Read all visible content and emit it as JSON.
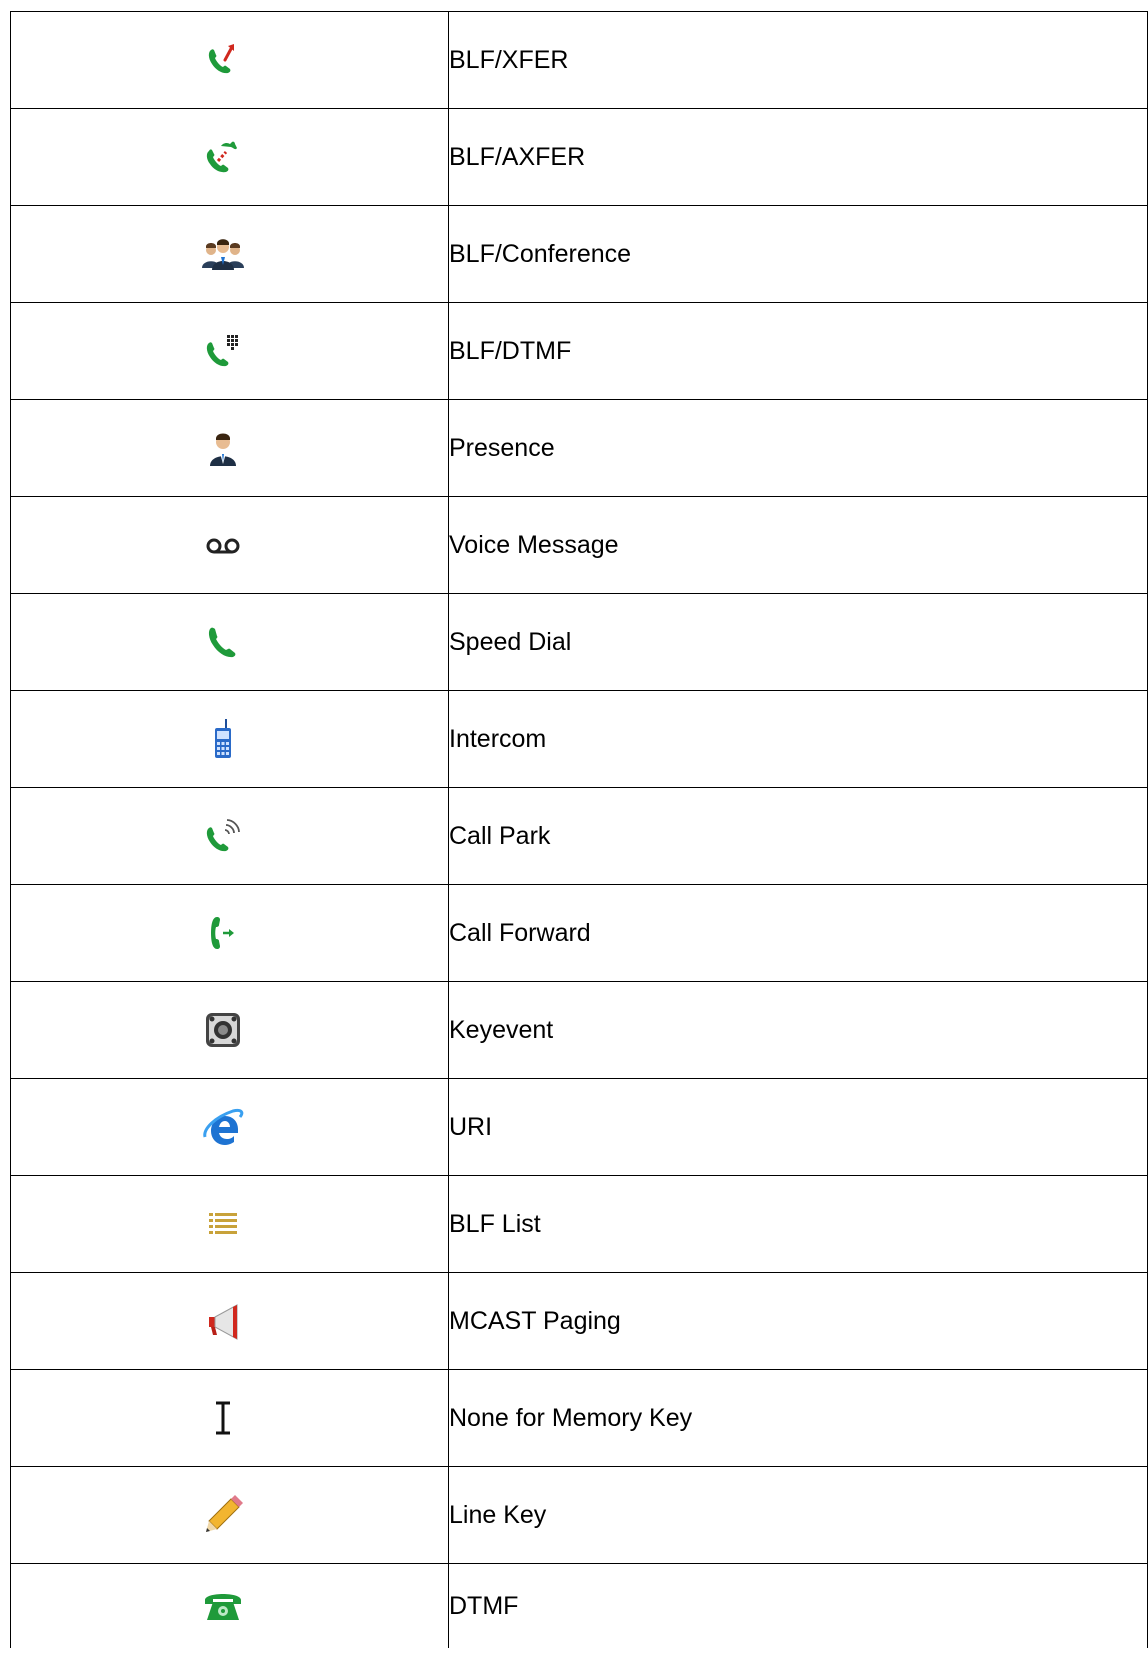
{
  "rows": [
    {
      "icon": "blf-xfer-icon",
      "label": "BLF/XFER"
    },
    {
      "icon": "blf-axfer-icon",
      "label": "BLF/AXFER"
    },
    {
      "icon": "conference-people-icon",
      "label": "BLF/Conference"
    },
    {
      "icon": "phone-keypad-icon",
      "label": "BLF/DTMF"
    },
    {
      "icon": "person-icon",
      "label": "Presence"
    },
    {
      "icon": "voicemail-icon",
      "label": "Voice Message"
    },
    {
      "icon": "phone-handset-icon",
      "label": "Speed Dial"
    },
    {
      "icon": "mobile-phone-icon",
      "label": "Intercom"
    },
    {
      "icon": "phone-wave-icon",
      "label": "Call Park"
    },
    {
      "icon": "phone-forward-icon",
      "label": "Call Forward"
    },
    {
      "icon": "speaker-icon",
      "label": "Keyevent"
    },
    {
      "icon": "internet-explorer-icon",
      "label": "URI"
    },
    {
      "icon": "list-icon",
      "label": "BLF List"
    },
    {
      "icon": "megaphone-icon",
      "label": "MCAST Paging"
    },
    {
      "icon": "text-cursor-icon",
      "label": "None for Memory Key"
    },
    {
      "icon": "pencil-icon",
      "label": "Line Key"
    },
    {
      "icon": "desk-phone-icon",
      "label": "DTMF"
    }
  ],
  "colors": {
    "phone_green": "#1f9a3a",
    "arrow_red": "#d0281e",
    "ie_blue": "#1e73d2",
    "list_gold": "#c8a23a",
    "border": "#000000"
  }
}
